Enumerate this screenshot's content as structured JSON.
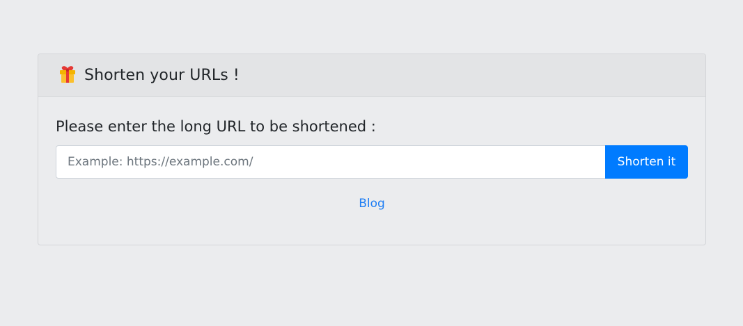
{
  "card": {
    "title": "Shorten your URLs !",
    "header_icon": "gift-icon"
  },
  "form": {
    "prompt": "Please enter the long URL to be shortened :",
    "url_input": {
      "value": "",
      "placeholder": "Example: https://example.com/"
    },
    "submit_label": "Shorten it"
  },
  "links": {
    "blog_label": "Blog"
  },
  "colors": {
    "page_background": "#ebecee",
    "header_background": "#e3e4e6",
    "primary_button": "#007bff",
    "link": "#1f7ef4"
  }
}
